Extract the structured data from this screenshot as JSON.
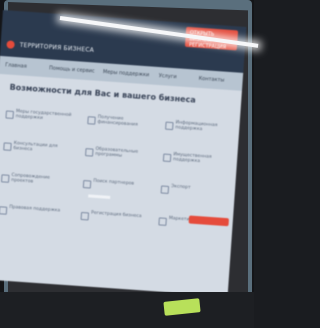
{
  "app": {
    "logo": "ТЕРРИТОРИЯ БИЗНЕСА",
    "badge_text": "ОТКРЫТЬ БИЗНЕС, РЕГИСТРАЦИЯ"
  },
  "nav": {
    "items": [
      "Главная",
      "Помощь и сервис",
      "Меры поддержки",
      "Услуги",
      "Контакты"
    ]
  },
  "main": {
    "title": "Возможности для Вас и вашего бизнеса",
    "items": [
      "Меры государственной поддержки",
      "Получение финансирования",
      "Информационная поддержка",
      "Консультации для бизнеса",
      "Образовательные программы",
      "Имущественная поддержка",
      "Сопровождение проектов",
      "Поиск партнеров",
      "Экспорт",
      "Правовая поддержка",
      "Регистрация бизнеса",
      "Маркетинг"
    ]
  },
  "colors": {
    "accent": "#e54b3b",
    "topbar": "#2b3a4f",
    "background": "#d4dbe4"
  }
}
